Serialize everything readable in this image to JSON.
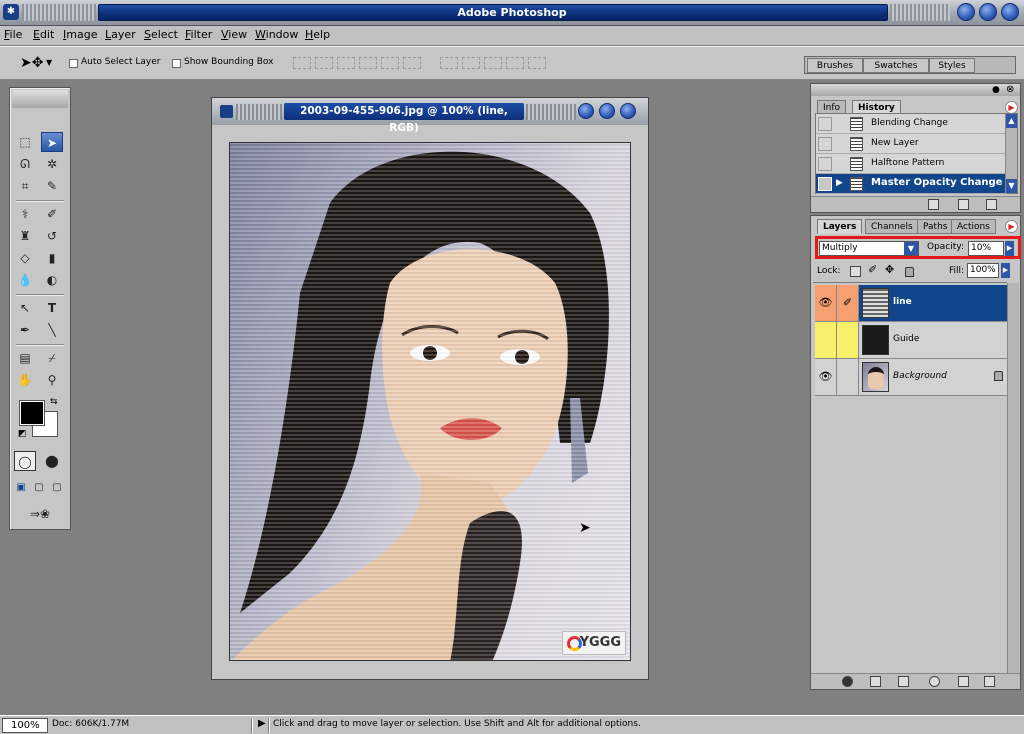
{
  "app": {
    "title": "Adobe Photoshop"
  },
  "menu": [
    "File",
    "Edit",
    "Image",
    "Layer",
    "Select",
    "Filter",
    "View",
    "Window",
    "Help"
  ],
  "options": {
    "auto_select_layer": "Auto Select Layer",
    "show_bounding_box": "Show Bounding Box",
    "well_tabs": [
      "Brushes",
      "Swatches",
      "Styles"
    ]
  },
  "document": {
    "title": "2003-09-455-906.jpg @ 100% (line, RGB)",
    "watermark": "YGGG"
  },
  "history_palette": {
    "tabs": [
      "Info",
      "History"
    ],
    "active_tab": "History",
    "items": [
      "Blending Change",
      "New Layer",
      "Halftone Pattern",
      "Master Opacity Change"
    ],
    "current": "Master Opacity Change"
  },
  "layers_palette": {
    "tabs": [
      "Layers",
      "Channels",
      "Paths",
      "Actions"
    ],
    "active_tab": "Layers",
    "blend_mode": "Multiply",
    "opacity_label": "Opacity:",
    "opacity_value": "10%",
    "lock_label": "Lock:",
    "fill_label": "Fill:",
    "fill_value": "100%",
    "layers": [
      {
        "name": "line",
        "visible": true,
        "selected": true,
        "color": "#f4a070"
      },
      {
        "name": "Guide",
        "visible": false,
        "selected": false,
        "color": "#f7f06a"
      },
      {
        "name": "Background",
        "visible": true,
        "selected": false,
        "locked": true
      }
    ]
  },
  "status": {
    "zoom": "100%",
    "doc": "Doc: 606K/1.77M",
    "hint": "Click and drag to move layer or selection.  Use Shift and Alt for additional options."
  },
  "colors": {
    "accent": "#12468a",
    "highlight": "#e21a1a"
  }
}
